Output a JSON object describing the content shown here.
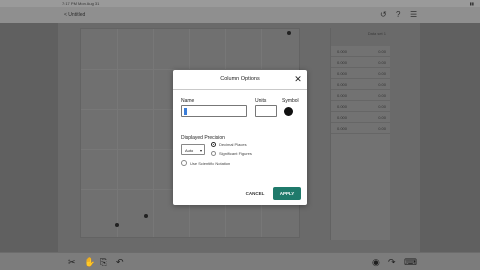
{
  "status_bar": {
    "time_date": "7:17 PM   Mon Aug 31",
    "battery": "▮▮"
  },
  "top_bar": {
    "back_label": "< Untitled",
    "icons": [
      "undo-icon",
      "help-icon",
      "menu-icon"
    ],
    "undo_glyph": "↺",
    "help_glyph": "?",
    "menu_glyph": "☰"
  },
  "table": {
    "header": "Data set 1",
    "rows": [
      {
        "x": "0.000",
        "y": "0.00"
      },
      {
        "x": "0.000",
        "y": "0.00"
      },
      {
        "x": "0.000",
        "y": "0.00"
      },
      {
        "x": "0.000",
        "y": "0.00"
      },
      {
        "x": "0.000",
        "y": "0.00"
      },
      {
        "x": "0.000",
        "y": "0.00"
      },
      {
        "x": "0.000",
        "y": "0.00"
      },
      {
        "x": "0.000",
        "y": "0.00"
      }
    ]
  },
  "dialog": {
    "title": "Column Options",
    "close_glyph": "✕",
    "name_label": "Name",
    "name_value": "",
    "units_label": "Units",
    "units_value": "",
    "symbol_label": "Symbol",
    "precision_label": "Displayed Precision",
    "precision_value": "Auto",
    "precision_caret": "▾",
    "radio_decimal": "Decimal Places",
    "radio_significant": "Significant Figures",
    "scientific_label": "Use Scientific Notation",
    "cancel_label": "CANCEL",
    "apply_label": "APPLY",
    "accent_color": "#1f7a6b"
  },
  "bottom_bar": {
    "icons": [
      "scissors-icon",
      "hand-icon",
      "clipboard-icon",
      "undo-icon",
      "redo-icon",
      "camera-icon",
      "keyboard-icon"
    ],
    "scissors_glyph": "✂",
    "hand_glyph": "✋",
    "clipboard_glyph": "⎘",
    "undo_glyph": "↶",
    "redo_glyph": "↷",
    "camera_glyph": "◉",
    "keyboard_glyph": "⌨"
  }
}
